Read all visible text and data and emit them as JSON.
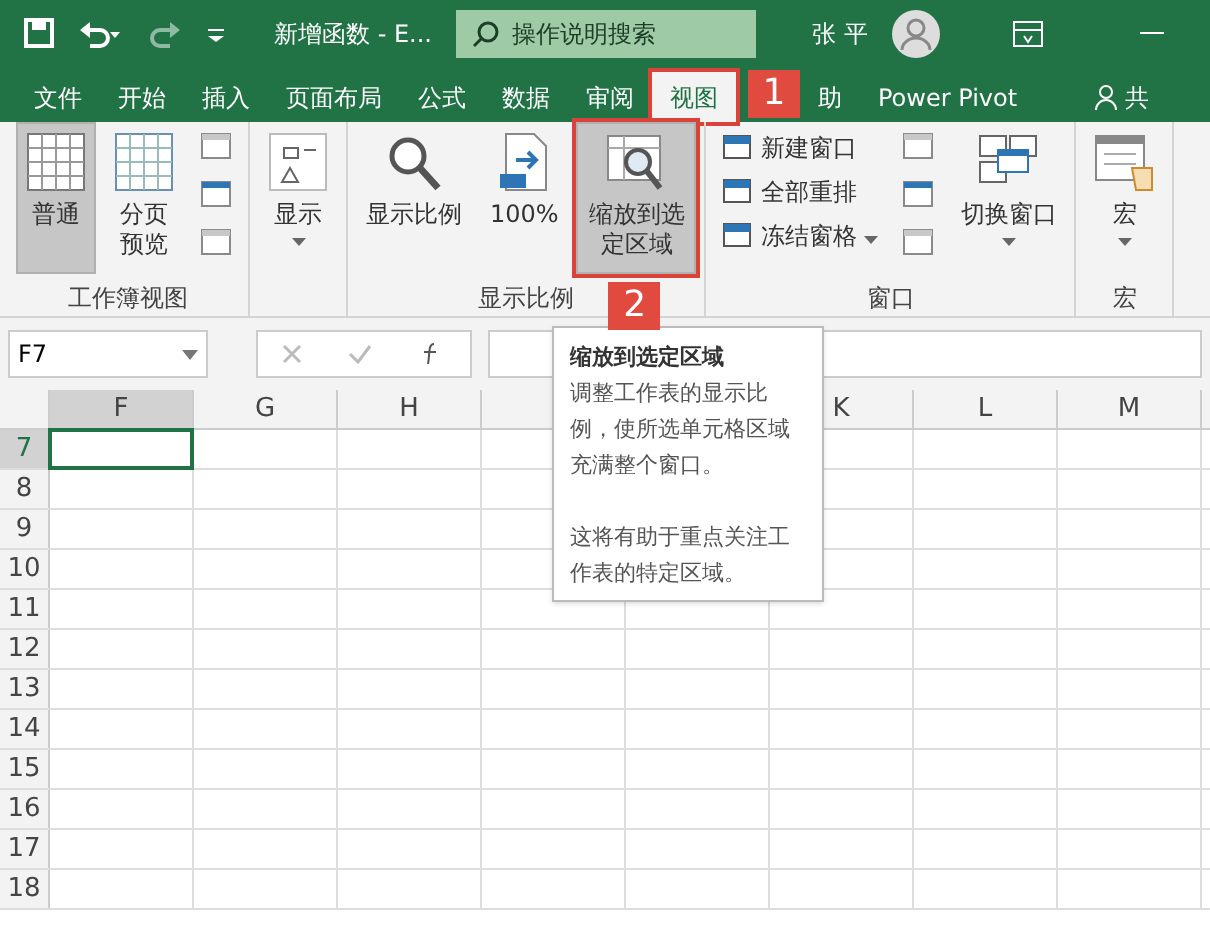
{
  "title_bar": {
    "document": "新增函数 - E...",
    "search_placeholder": "操作说明搜索",
    "user": "张 平"
  },
  "tabs": [
    {
      "label": "文件",
      "selected": false
    },
    {
      "label": "开始",
      "selected": false
    },
    {
      "label": "插入",
      "selected": false
    },
    {
      "label": "页面布局",
      "selected": false
    },
    {
      "label": "公式",
      "selected": false
    },
    {
      "label": "数据",
      "selected": false
    },
    {
      "label": "审阅",
      "selected": false
    },
    {
      "label": "视图",
      "selected": true,
      "callout": "1"
    },
    {
      "label": "助",
      "selected": false
    },
    {
      "label": "Power Pivot",
      "selected": false
    },
    {
      "label": "共",
      "selected": false,
      "kind": "share"
    }
  ],
  "ribbon": {
    "groups": [
      {
        "label": "工作簿视图",
        "items": [
          {
            "kind": "big",
            "label": "普通",
            "selected": true
          },
          {
            "kind": "big",
            "label": "分页预览",
            "selected": false
          },
          {
            "kind": "smallicons"
          }
        ]
      },
      {
        "items": [
          {
            "kind": "big",
            "label": "显示",
            "selected": false,
            "dropdown": true
          }
        ]
      },
      {
        "label": "显示比例",
        "items": [
          {
            "kind": "big",
            "label": "显示比例",
            "selected": false
          },
          {
            "kind": "big",
            "label": "100%",
            "selected": false
          },
          {
            "kind": "big",
            "label": "缩放到选定区域",
            "selected": true,
            "callout": "2"
          }
        ]
      },
      {
        "label": "窗口",
        "items": [
          {
            "kind": "list",
            "entries": [
              {
                "label": "新建窗口"
              },
              {
                "label": "全部重排"
              },
              {
                "label": "冻结窗格",
                "dropdown": true
              }
            ]
          },
          {
            "kind": "smallicons"
          },
          {
            "kind": "big",
            "label": "切换窗口",
            "selected": false,
            "dropdown": true
          }
        ]
      },
      {
        "label": "宏",
        "items": [
          {
            "kind": "big",
            "label": "宏",
            "selected": false,
            "dropdown": true
          }
        ]
      }
    ]
  },
  "formula_bar": {
    "name_box": "F7"
  },
  "sheet": {
    "columns": [
      {
        "label": "F",
        "selected": true
      },
      {
        "label": "G",
        "selected": false
      },
      {
        "label": "H",
        "selected": false
      }
    ],
    "columns_after_tooltip": [
      {
        "label": "K",
        "selected": false
      },
      {
        "label": "L",
        "selected": false
      },
      {
        "label": "M",
        "selected": false
      }
    ],
    "rows": [
      {
        "label": "7",
        "selected": true
      },
      {
        "label": "8",
        "selected": false
      },
      {
        "label": "9",
        "selected": false
      },
      {
        "label": "10",
        "selected": false
      },
      {
        "label": "11",
        "selected": false
      },
      {
        "label": "12",
        "selected": false
      },
      {
        "label": "13",
        "selected": false
      },
      {
        "label": "14",
        "selected": false
      },
      {
        "label": "15",
        "selected": false
      },
      {
        "label": "16",
        "selected": false
      },
      {
        "label": "17",
        "selected": false
      },
      {
        "label": "18",
        "selected": false
      }
    ]
  },
  "tooltip": {
    "title": "缩放到选定区域",
    "paragraphs": [
      "调整工作表的显示比例，使所选单元格区域充满整个窗口。",
      "这将有助于重点关注工作表的特定区域。"
    ]
  }
}
